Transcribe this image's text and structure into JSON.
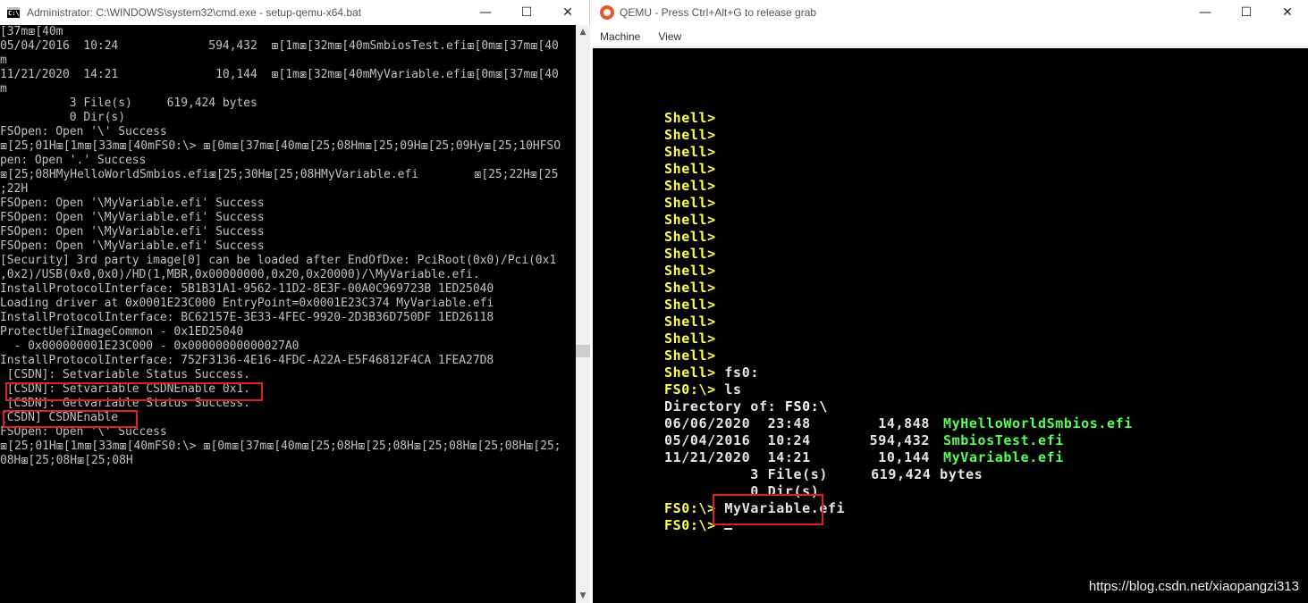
{
  "cmd_window": {
    "title": "Administrator: C:\\WINDOWS\\system32\\cmd.exe - setup-qemu-x64.bat",
    "icon": "cmd-icon",
    "minimize": "—",
    "maximize": "☐",
    "close": "✕",
    "lines": [
      "[37m⧆[40m",
      "05/04/2016  10:24             594,432  ⧆[1m⧆[32m⧆[40mSmbiosTest.efi⧆[0m⧆[37m⧆[40",
      "m",
      "11/21/2020  14:21              10,144  ⧆[1m⧆[32m⧆[40mMyVariable.efi⧆[0m⧆[37m⧆[40",
      "m",
      "          3 File(s)     619,424 bytes",
      "          0 Dir(s)",
      "FSOpen: Open '\\' Success",
      "⧆[25;01H⧆[1m⧆[33m⧆[40mFS0:\\> ⧆[0m⧆[37m⧆[40m⧆[25;08Hm⧆[25;09H⧆[25;09Hy⧆[25;10HFSO",
      "pen: Open '.' Success",
      "⧆[25;08HMyHelloWorldSmbios.efi⧆[25;30H⧆[25;08HMyVariable.efi        ⧆[25;22H⧆[25",
      ";22H",
      "FSOpen: Open '\\MyVariable.efi' Success",
      "FSOpen: Open '\\MyVariable.efi' Success",
      "FSOpen: Open '\\MyVariable.efi' Success",
      "FSOpen: Open '\\MyVariable.efi' Success",
      "[Security] 3rd party image[0] can be loaded after EndOfDxe: PciRoot(0x0)/Pci(0x1",
      ",0x2)/USB(0x0,0x0)/HD(1,MBR,0x00000000,0x20,0x20000)/\\MyVariable.efi.",
      "InstallProtocolInterface: 5B1B31A1-9562-11D2-8E3F-00A0C969723B 1ED25040",
      "Loading driver at 0x0001E23C000 EntryPoint=0x0001E23C374 MyVariable.efi",
      "InstallProtocolInterface: BC62157E-3E33-4FEC-9920-2D3B36D750DF 1ED26118",
      "ProtectUefiImageCommon - 0x1ED25040",
      "  - 0x000000001E23C000 - 0x00000000000027A0",
      "InstallProtocolInterface: 752F3136-4E16-4FDC-A22A-E5F46812F4CA 1FEA27D8",
      " [CSDN]: Setvariable Status Success.",
      " [CSDN]: Setvariable CSDNEnable 0x1.",
      " [CSDN]: Getvariable Status Success.",
      "[CSDN] CSDNEnable",
      "FSOpen: Open '\\' Success",
      "⧆[25;01H⧆[1m⧆[33m⧆[40mFS0:\\> ⧆[0m⧆[37m⧆[40m⧆[25;08H⧆[25;08H⧆[25;08H⧆[25;08H⧆[25;",
      "08H⧆[25;08H⧆[25;08H"
    ]
  },
  "qemu_window": {
    "title": "QEMU - Press Ctrl+Alt+G to release grab",
    "minimize": "—",
    "maximize": "☐",
    "close": "✕",
    "menu": [
      "Machine",
      "View"
    ],
    "shell_prompt": "Shell>",
    "shell_prompt_count": 15,
    "cmd_fs0": " fs0:",
    "fs0_prompt": "FS0:\\>",
    "cmd_ls": " ls",
    "dir_label": "Directory of: ",
    "dir_path": "FS0:\\",
    "files": [
      {
        "date": "06/06/2020  23:48",
        "size": "14,848",
        "name": "MyHelloWorldSmbios.efi"
      },
      {
        "date": "05/04/2016  10:24",
        "size": "594,432",
        "name": "SmbiosTest.efi"
      },
      {
        "date": "11/21/2020  14:21",
        "size": "10,144",
        "name": "MyVariable.efi"
      }
    ],
    "summary_files": "          3 File(s)     619,424 bytes",
    "summary_dirs": "          0 Dir(s)",
    "run_cmd": " MyVariable.efi"
  },
  "watermark": "https://blog.csdn.net/xiaopangzi313",
  "colors": {
    "prompt": "#ffff55",
    "file": "#55ff55",
    "highlight": "#e02020"
  }
}
